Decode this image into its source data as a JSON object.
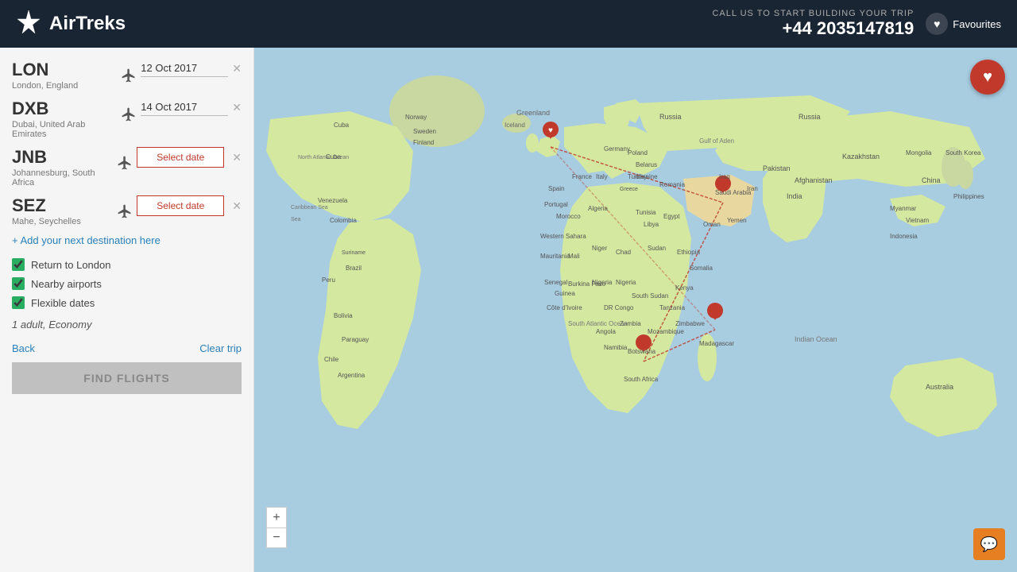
{
  "header": {
    "logo_text": "AirTreks",
    "call_label": "CALL US TO START BUILDING YOUR TRIP",
    "call_number": "+44 2035147819",
    "fav_label": "Favourites"
  },
  "sidebar": {
    "destinations": [
      {
        "code": "LON",
        "name": "London, England",
        "date": "12 Oct 2017",
        "has_date": true
      },
      {
        "code": "DXB",
        "name": "Dubai, United Arab Emirates",
        "date": "14 Oct 2017",
        "has_date": true
      },
      {
        "code": "JNB",
        "name": "Johannesburg, South Africa",
        "date": "",
        "has_date": false
      },
      {
        "code": "SEZ",
        "name": "Mahe, Seychelles",
        "date": "",
        "has_date": false
      }
    ],
    "add_destination_label": "+ Add your next destination here",
    "checkboxes": [
      {
        "label": "Return to London",
        "checked": true
      },
      {
        "label": "Nearby airports",
        "checked": true
      },
      {
        "label": "Flexible dates",
        "checked": true
      }
    ],
    "pax": "1 adult, Economy",
    "back_label": "Back",
    "clear_label": "Clear trip",
    "find_flights_label": "FIND FLIGHTS"
  },
  "map": {
    "fav_icon": "♥",
    "zoom_in": "+",
    "zoom_out": "−",
    "chat_icon": "💬"
  }
}
